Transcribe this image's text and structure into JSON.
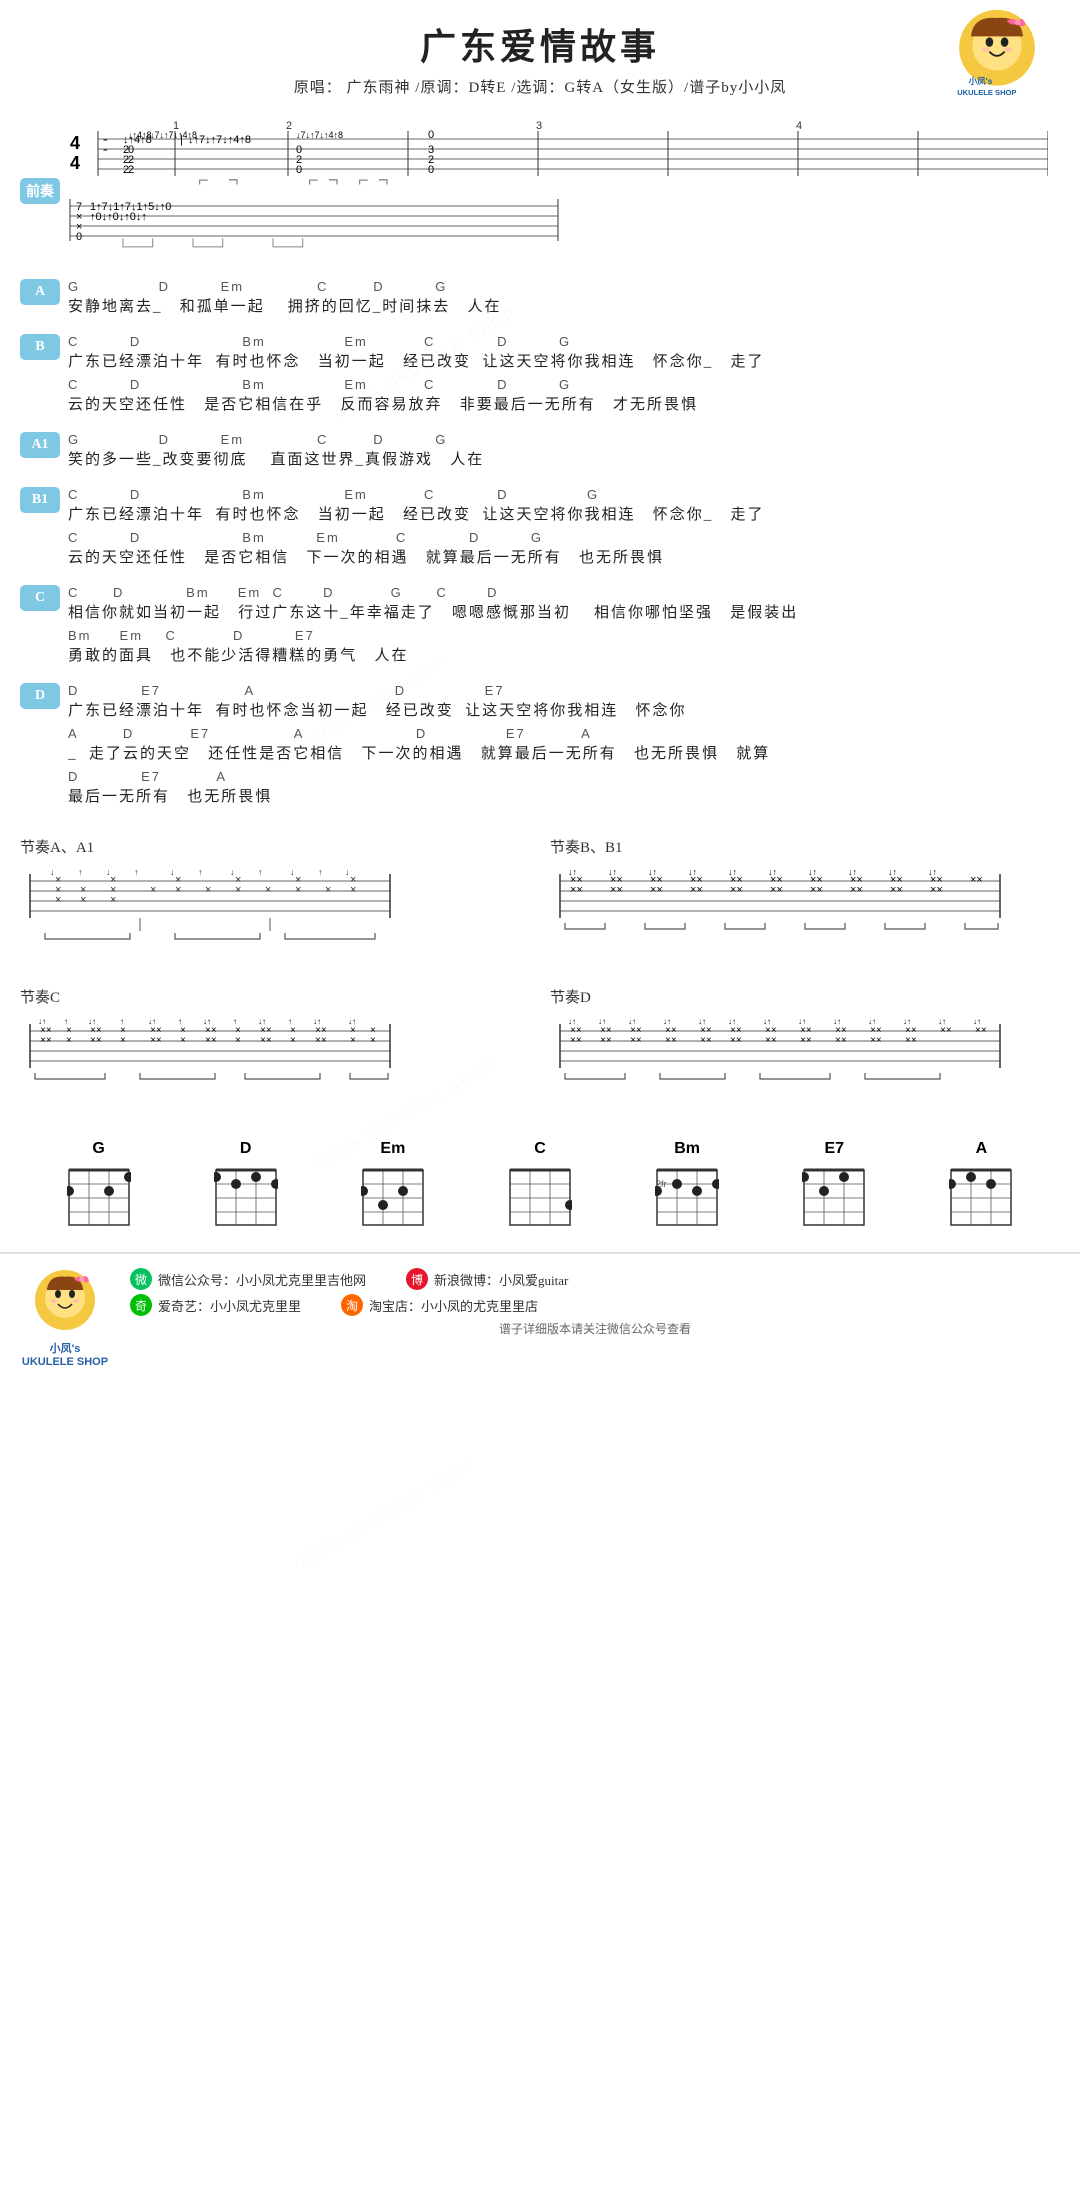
{
  "header": {
    "title": "广东爱情故事",
    "info": "原唱： 广东雨神 /原调：D转E /选调：G转A（女生版）/谱子by小小凤"
  },
  "shop": {
    "name": "小凤's",
    "subtitle": "UKULELE SHOP"
  },
  "sections": {
    "intro_label": "前奏",
    "A_label": "A",
    "B_label": "B",
    "A1_label": "A1",
    "B1_label": "B1",
    "C_label": "C",
    "D_label": "D"
  },
  "chords": {
    "A": {
      "chord_line": "G              D         Em             C        D         G",
      "lyric_line": "安静地离去_   和孤单一起    拥挤的回忆_时间抹去   人在"
    },
    "B_line1": {
      "chord_line": "C         D                  Bm              Em          C           D         G",
      "lyric_line": "广东已经漂泊十年  有时也怀念   当初一起   经已改变  让这天空将你我相连   怀念你_   走了"
    },
    "B_line2": {
      "chord_line": "C         D                  Bm              Em          C           D         G",
      "lyric_line": "云的天空还任性   是否它相信在乎   反而容易放弃   非要最后一无所有   才无所畏惧"
    },
    "A1": {
      "chord_line": "G              D         Em             C        D         G",
      "lyric_line": "笑的多一些_改变要彻底    直面这世界_真假游戏   人在"
    },
    "B1_line1": {
      "chord_line": "C         D                  Bm              Em          C           D              G",
      "lyric_line": "广东已经漂泊十年  有时也怀念   当初一起   经已改变  让这天空将你我相连   怀念你_   走了"
    },
    "B1_line2": {
      "chord_line": "C         D                  Bm         Em          C           D         G",
      "lyric_line": "云的天空还任性   是否它相信   下一次的相遇   就算最后一无所有   也无所畏惧"
    },
    "C_line1": {
      "chord_line": "C      D           Bm     Em  C       D          G      C       D",
      "lyric_line": "相信你就如当初一起   行过广东这十_年幸福走了   嗯嗯感慨那当初    相信你哪怕坚强   是假装出"
    },
    "C_line2": {
      "chord_line": "Bm     Em    C          D         E7",
      "lyric_line": "勇敢的面具   也不能少活得糟糕的勇气   人在"
    },
    "D_line1": {
      "chord_line": "D           E7               A                         D              E7",
      "lyric_line": "广东已经漂泊十年  有时也怀念当初一起   经已改变  让这天空将你我相连   怀念你"
    },
    "D_line2": {
      "chord_line": "A        D          E7               A                    D              E7          A",
      "lyric_line": "_  走了云的天空   还任性是否它相信   下一次的相遇   就算最后一无所有   也无所畏惧   就算"
    },
    "D_line3": {
      "chord_line": "D           E7          A",
      "lyric_line": "最后一无所有   也无所畏惧"
    }
  },
  "rhythm": {
    "A_A1_label": "节奏A、A1",
    "B_B1_label": "节奏B、B1",
    "C_label": "节奏C",
    "D_label": "节奏D"
  },
  "chord_diagrams": {
    "chords": [
      {
        "name": "G",
        "dots": [
          [
            0,
            1
          ],
          [
            1,
            2
          ],
          [
            2,
            2
          ]
        ]
      },
      {
        "name": "D",
        "dots": [
          [
            0,
            2
          ],
          [
            1,
            1
          ],
          [
            2,
            2
          ]
        ]
      },
      {
        "name": "Em",
        "dots": [
          [
            0,
            3
          ],
          [
            1,
            2
          ],
          [
            2,
            0
          ]
        ]
      },
      {
        "name": "C",
        "dots": [
          [
            0,
            0
          ],
          [
            1,
            0
          ],
          [
            2,
            3
          ]
        ]
      },
      {
        "name": "Bm",
        "dots": [
          [
            0,
            2
          ],
          [
            1,
            3
          ],
          [
            2,
            2
          ]
        ]
      },
      {
        "name": "E7",
        "dots": [
          [
            0,
            1
          ],
          [
            1,
            2
          ],
          [
            2,
            0
          ]
        ]
      },
      {
        "name": "A",
        "dots": [
          [
            0,
            2
          ],
          [
            1,
            1
          ],
          [
            2,
            0
          ]
        ]
      }
    ]
  },
  "footer": {
    "wechat_label": "微信公众号：小小凤尤克里里吉他网",
    "weibo_label": "新浪微博：小凤爱guitar",
    "iqiyi_label": "爱奇艺：小小凤尤克里里",
    "taobao_label": "淘宝店：小小凤的尤克里里店",
    "note": "谱子详细版本请关注微信公众号查看"
  }
}
